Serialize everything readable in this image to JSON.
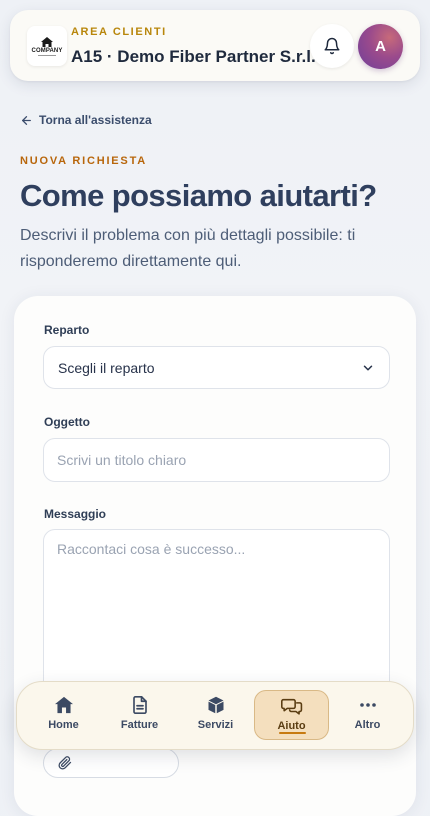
{
  "header": {
    "logo_text": "COMPANY",
    "area_label": "AREA CLIENTI",
    "company_name": "A15 · Demo Fiber Partner S.r.l.",
    "avatar_initial": "A",
    "icons": {
      "bell": "bell-icon",
      "logo": "company-logo-icon"
    }
  },
  "nav_back": {
    "label": "Torna all'assistenza",
    "icon": "arrow-left-icon"
  },
  "page": {
    "eyebrow": "NUOVA RICHIESTA",
    "title": "Come possiamo aiutarti?",
    "description": "Descrivi il problema con più dettagli possibile: ti risponderemo direttamente qui."
  },
  "form": {
    "department": {
      "label": "Reparto",
      "value": "Scegli il reparto",
      "icon": "chevron-down-icon"
    },
    "subject": {
      "label": "Oggetto",
      "value": "",
      "placeholder": "Scrivi un titolo chiaro"
    },
    "message": {
      "label": "Messaggio",
      "value": "",
      "placeholder": "Raccontaci cosa è successo..."
    },
    "attachment": {
      "icon": "paperclip-icon"
    }
  },
  "bottom_nav": {
    "items": [
      {
        "label": "Home",
        "icon": "home-icon"
      },
      {
        "label": "Fatture",
        "icon": "document-icon"
      },
      {
        "label": "Servizi",
        "icon": "box-icon"
      },
      {
        "label": "Aiuto",
        "icon": "chat-icon"
      },
      {
        "label": "Altro",
        "icon": "more-dots-icon"
      }
    ],
    "active": "Aiuto"
  },
  "colors": {
    "accent": "#b8860b",
    "active_nav_bg": "#f4dfbe",
    "title": "#2f3f5e",
    "avatar": "#9a4a8c"
  }
}
